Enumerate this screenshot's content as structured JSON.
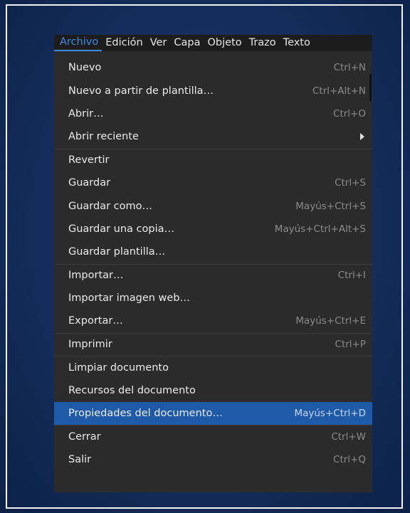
{
  "menubar": [
    "Archivo",
    "Edición",
    "Ver",
    "Capa",
    "Objeto",
    "Trazo",
    "Texto"
  ],
  "items": [
    {
      "label": "Nuevo",
      "shortcut": "Ctrl+N"
    },
    {
      "label": "Nuevo a partir de plantilla…",
      "shortcut": "Ctrl+Alt+N"
    },
    {
      "label": "Abrir…",
      "shortcut": "Ctrl+O"
    },
    {
      "label": "Abrir reciente",
      "shortcut": "",
      "submenu": true
    },
    {
      "label": "Revertir",
      "shortcut": "",
      "separator": true
    },
    {
      "label": "Guardar",
      "shortcut": "Ctrl+S"
    },
    {
      "label": "Guardar como…",
      "shortcut": "Mayús+Ctrl+S"
    },
    {
      "label": "Guardar una copia…",
      "shortcut": "Mayús+Ctrl+Alt+S"
    },
    {
      "label": "Guardar plantilla…",
      "shortcut": ""
    },
    {
      "label": "Importar…",
      "shortcut": "Ctrl+I",
      "separator": true
    },
    {
      "label": "Importar imagen web…",
      "shortcut": ""
    },
    {
      "label": "Exportar…",
      "shortcut": "Mayús+Ctrl+E"
    },
    {
      "label": "Imprimir",
      "shortcut": "Ctrl+P",
      "separator": true
    },
    {
      "label": "Limpiar documento",
      "shortcut": "",
      "separator": true
    },
    {
      "label": "Recursos del documento",
      "shortcut": ""
    },
    {
      "label": "Propiedades del documento…",
      "shortcut": "Mayús+Ctrl+D",
      "highlighted": true
    },
    {
      "label": "Cerrar",
      "shortcut": "Ctrl+W",
      "separator": true
    },
    {
      "label": "Salir",
      "shortcut": "Ctrl+Q"
    }
  ],
  "colors": {
    "highlight": "#1f5aa8",
    "menubar_active": "#3e8be6",
    "menu_bg": "#2b2b2b"
  }
}
